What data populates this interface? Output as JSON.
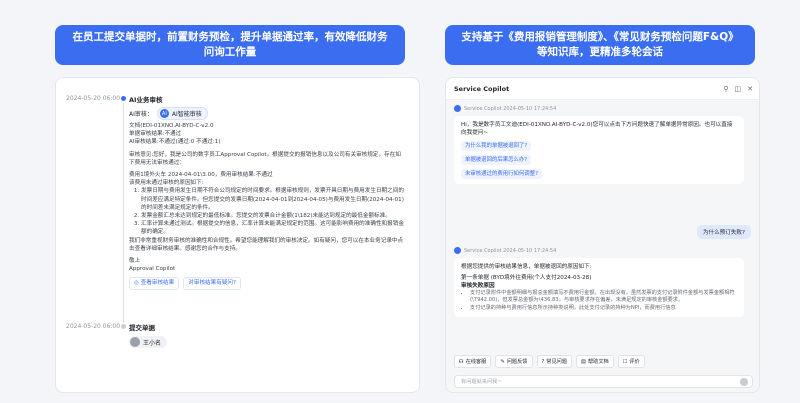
{
  "banners": {
    "left": "在员工提交单据时，前置财务预检，提升单据通过率，有效降低财务问询工作量",
    "right": "支持基于《费用报销管理制度》、《常见财务预检问题F&Q》等知识库，更精准多轮会话"
  },
  "timeline": {
    "entry1": {
      "time": "2024-05-20 06:00",
      "title": "AI业务审核",
      "audit_label": "AI审核：",
      "ai_badge": "AI智能审核",
      "lines": [
        "文档(EDI-01XNO.AI-BYD-C-v2.0",
        "单据审核结果:不通过",
        "AI审核结果:不通过(通过:0 不通过:1)"
      ],
      "intro": "审核意见:您好，我是公司的数字员工Approval Copilot。根据提交的报销信息以及公司有关审核规定，存在如下费用无法审核通过：",
      "sub_title": "费用1境外火车 2024-04-01\\3.00，费用审核结果:不通过",
      "reason_title": "该费用未通过审核的原因如下:",
      "reasons": [
        "发票日期与费用发生日期不符合公司规定的时间要求。根据审核规则，发票开具日期与费用发生日期之间的时间差应满足特定条件。但您提交的发票日期(2024-04-01到2024-04-05)与费用发生日期(2024-04-01)的时间差未满足规定的条件。",
        "发票金额汇总未达到规定的最低标准。您提交的发票合计金额(1\\182)未能达到规定的最低金额标准。",
        "汇率计算未通过测试。根据提交的信息，汇率计算未能满足规定的范围。这可能影响费用的准确性和报销金额的确定。"
      ],
      "closing": "我们非常重视财务审核的准确性和合规性。希望您能理解我们的审核决定。如有疑问，您可以在本业务记录中点击查看详细审核结果。感谢您的合作与支持。",
      "regards": "敬上",
      "sign": "Approval Copilot",
      "link_view": "查看审核结果",
      "link_question": "对审核结果有疑问?"
    },
    "entry2": {
      "time": "2024-05-20 06:00",
      "title": "提交单据",
      "user": "王小名"
    }
  },
  "copilot": {
    "title": "Service Copilot",
    "msg1_meta": "Service Copilot  2024-05-10 17:24:54",
    "greeting": "Hi，我是数字员工文迪(EDI-01XNO.AI-BYD-C-v2.0)您可以点击下方问题快速了解单据异常原因。也可以直接向我提问~",
    "suggestions": [
      "为什么我的单据被退回了?",
      "单据被退回的后果怎么办?",
      "未审核通过的费用行如何调整?"
    ],
    "user_message": "为什么预订失败?",
    "msg2_meta": "Service Copilot  2024-05-10 17:24:54",
    "answer_intro": "根据您提供的审核结果信息，单据被退回的原因如下:",
    "expense_line": "第一条单据 (BYD境外往费用(个人支付2024-03-28)",
    "reason_header": "审核失败原因",
    "answer_bullets": [
      "支付记录附件中金额明细与报总金额填写不费用行金额，在出现没有，虽然发票的支付记录附件金额与发票金额相符(\\7942.00)，但发票总金额为\\436.83，与审核要求存在偏差，未满足规定的审核金额要求。",
      "支付记录的持种与费用行信息所示持种类说明，此处支付记录的持种为NPI，而费用行信息"
    ],
    "actions": [
      "在线客服",
      "问题反馈",
      "常见问题",
      "帮助文档",
      "评价"
    ],
    "input_placeholder": "有问题就来问我~"
  }
}
